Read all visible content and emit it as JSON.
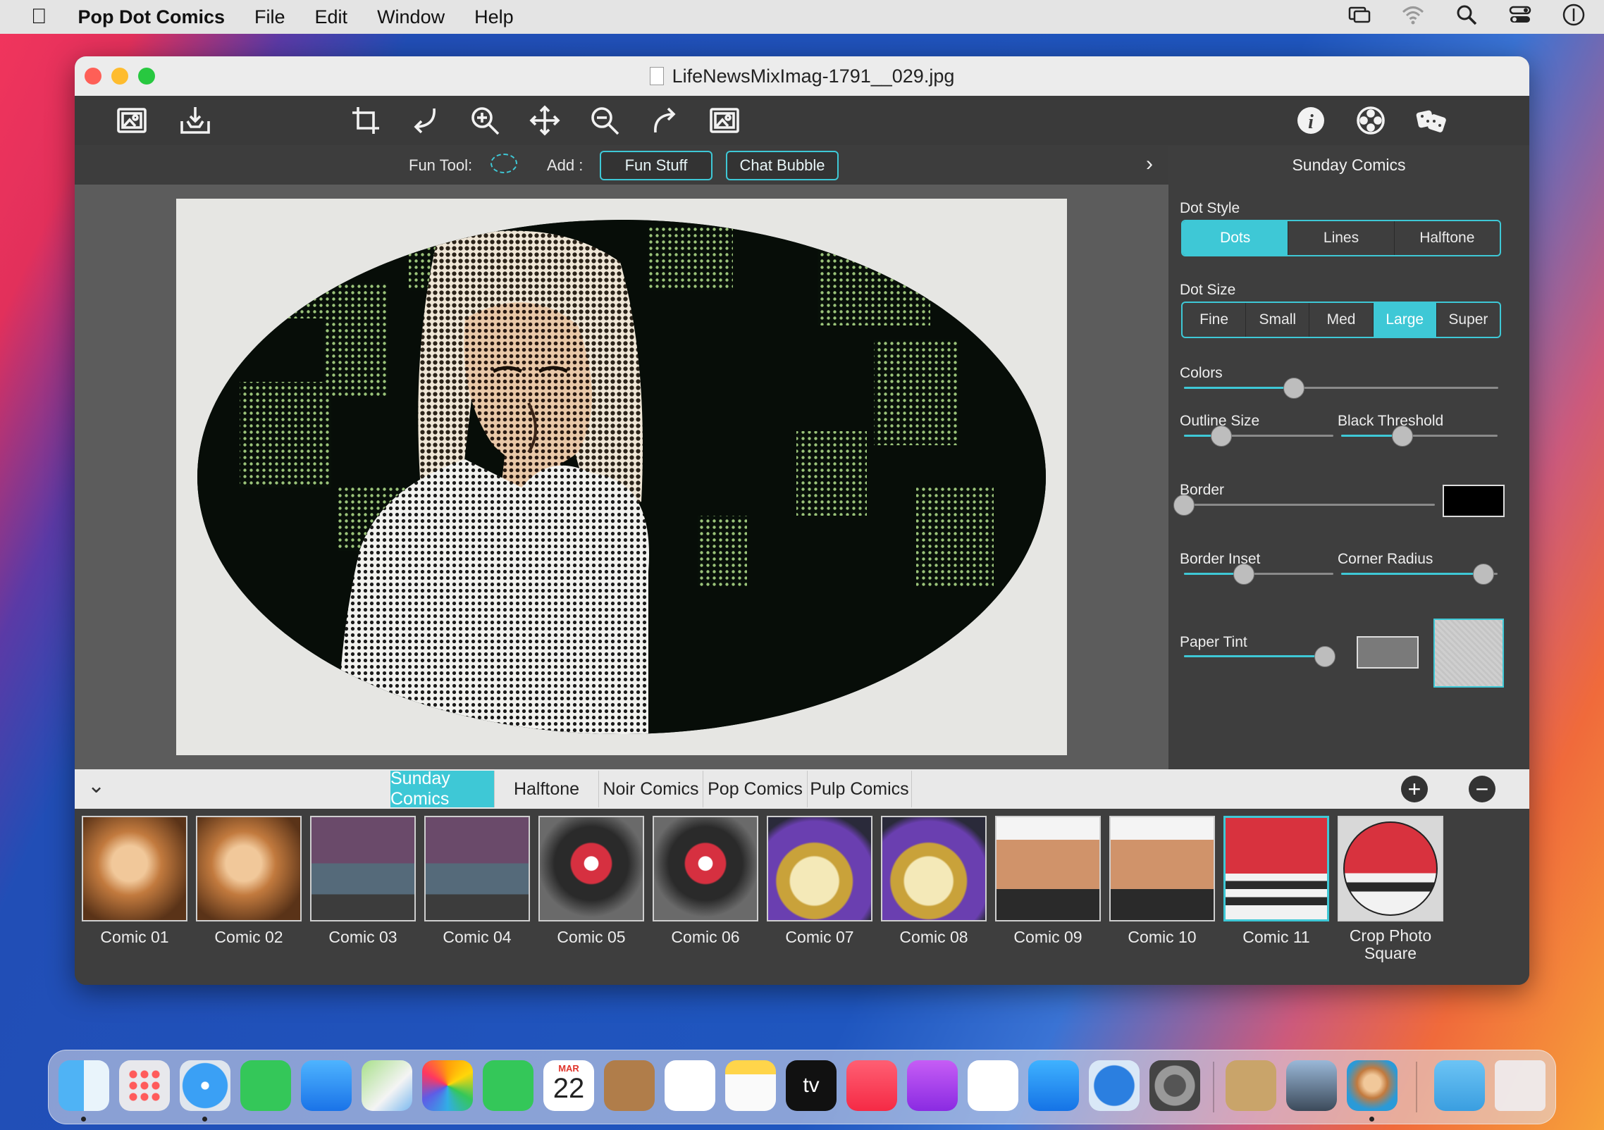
{
  "menubar": {
    "app": "Pop Dot Comics",
    "items": [
      "File",
      "Edit",
      "Window",
      "Help"
    ]
  },
  "window": {
    "title": "LifeNewsMixImag-1791__029.jpg"
  },
  "subbar": {
    "fun_tool_label": "Fun Tool:",
    "add_label": "Add :",
    "fun_stuff": "Fun Stuff",
    "chat_bubble": "Chat Bubble"
  },
  "panel": {
    "title": "Sunday Comics",
    "dot_style": {
      "label": "Dot Style",
      "options": [
        "Dots",
        "Lines",
        "Halftone"
      ],
      "selected": "Dots"
    },
    "dot_size": {
      "label": "Dot Size",
      "options": [
        "Fine",
        "Small",
        "Med",
        "Large",
        "Super"
      ],
      "selected": "Large"
    },
    "colors": {
      "label": "Colors",
      "value": 0.35
    },
    "outline_size": {
      "label": "Outline Size",
      "value": 0.25
    },
    "black_threshold": {
      "label": "Black Threshold",
      "value": 0.39
    },
    "border": {
      "label": "Border",
      "value": 0.0,
      "color": "#000000"
    },
    "border_inset": {
      "label": "Border Inset",
      "value": 0.4
    },
    "corner_radius": {
      "label": "Corner Radius",
      "value": 0.91
    },
    "paper_tint": {
      "label": "Paper Tint",
      "value": 1.0,
      "color": "#7a7a7a"
    }
  },
  "tabs": {
    "items": [
      "Sunday Comics",
      "Halftone",
      "Noir Comics",
      "Pop Comics",
      "Pulp Comics"
    ],
    "selected": "Sunday Comics"
  },
  "thumbs": {
    "items": [
      "Comic 01",
      "Comic 02",
      "Comic 03",
      "Comic 04",
      "Comic 05",
      "Comic 06",
      "Comic 07",
      "Comic 08",
      "Comic 09",
      "Comic 10",
      "Comic 11",
      "Crop Photo Square"
    ],
    "selected": "Comic 11"
  },
  "dock": {
    "calendar_month": "MAR",
    "calendar_day": "22",
    "tv_label": "tv"
  },
  "colors": {
    "accent": "#3ec8d6"
  }
}
